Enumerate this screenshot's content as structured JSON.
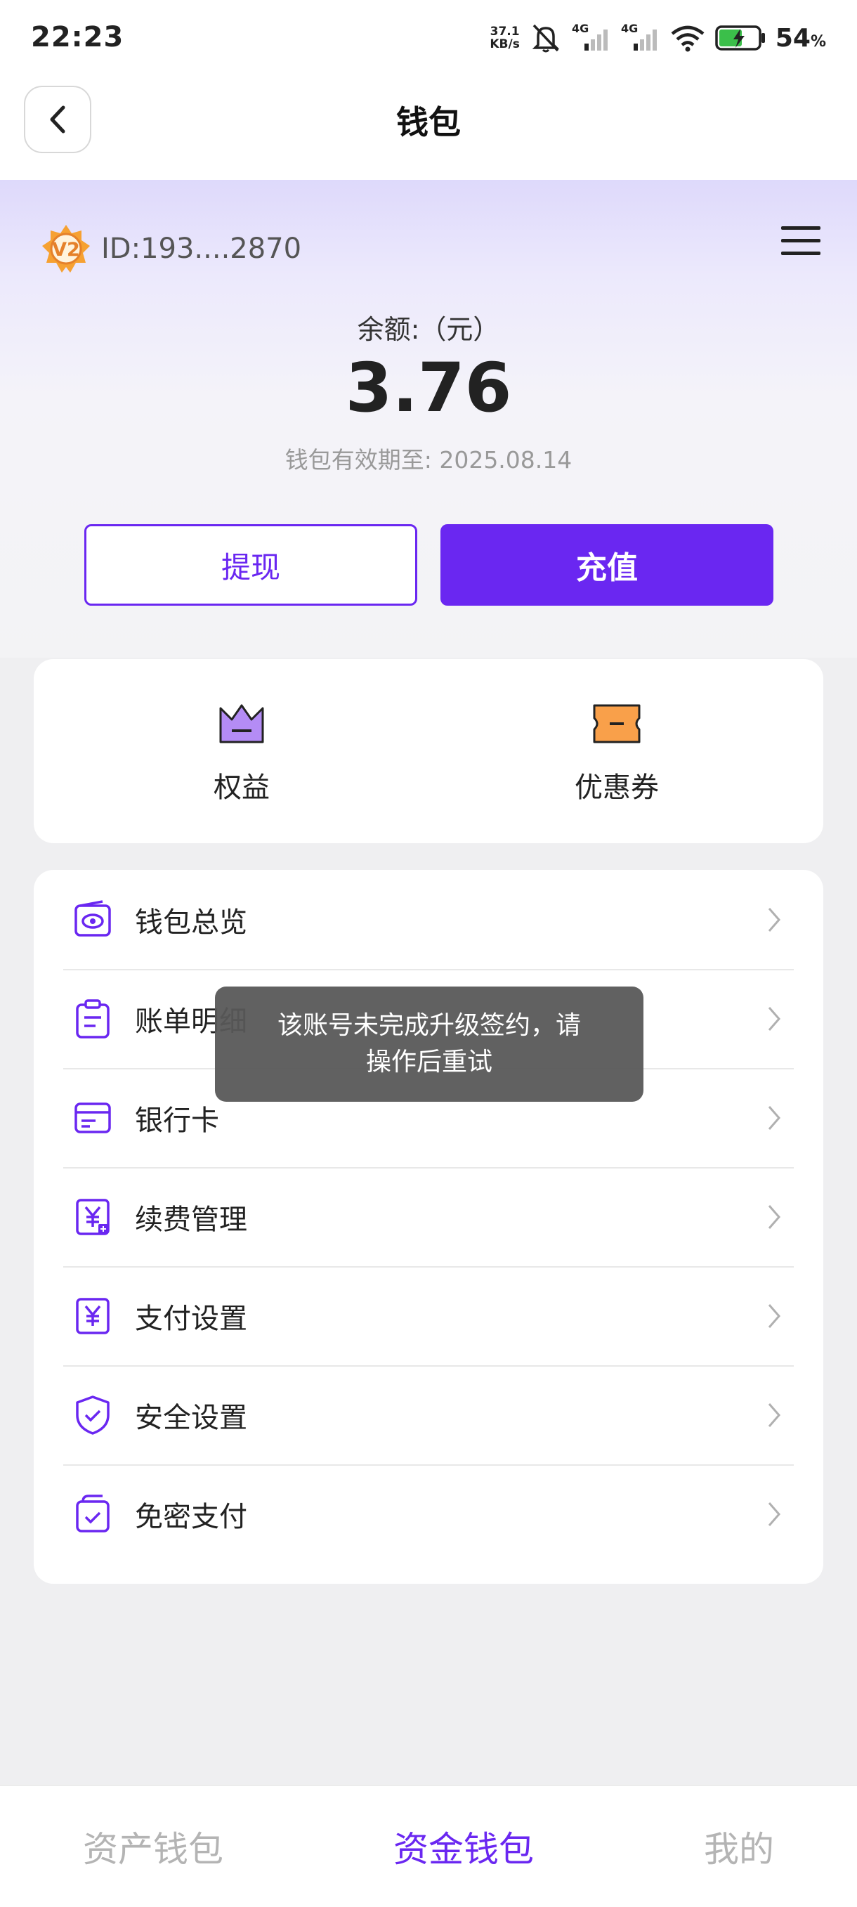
{
  "status_bar": {
    "time": "22:23",
    "net_speed_value": "37.1",
    "net_speed_unit": "KB/s",
    "sim1": "4G",
    "sim2": "4G",
    "battery": "54",
    "battery_unit": "%"
  },
  "header": {
    "title": "钱包",
    "back_icon": "chevron-left-icon"
  },
  "account": {
    "vip_badge_text": "V2",
    "user_id": "ID:193....2870",
    "menu_icon": "hamburger-menu-icon"
  },
  "balance": {
    "label": "余额:（元）",
    "value": "3.76",
    "validity": "钱包有效期至: 2025.08.14"
  },
  "actions": {
    "withdraw_label": "提现",
    "recharge_label": "充值"
  },
  "quick": [
    {
      "label": "权益",
      "icon": "crown-icon",
      "color": "#b48cf5"
    },
    {
      "label": "优惠券",
      "icon": "coupon-icon",
      "color": "#f9a04a"
    }
  ],
  "menu_items": [
    {
      "label": "钱包总览",
      "icon": "wallet-eye-icon"
    },
    {
      "label": "账单明细",
      "icon": "bill-clipboard-icon"
    },
    {
      "label": "银行卡",
      "icon": "bank-card-icon"
    },
    {
      "label": "续费管理",
      "icon": "renewal-yen-icon"
    },
    {
      "label": "支付设置",
      "icon": "payment-yen-icon"
    },
    {
      "label": "安全设置",
      "icon": "shield-check-icon"
    },
    {
      "label": "免密支付",
      "icon": "password-free-icon"
    }
  ],
  "toast": {
    "line1": "该账号未完成升级签约，请",
    "line2": "操作后重试"
  },
  "bottom_nav": [
    {
      "label": "资产钱包",
      "active": false
    },
    {
      "label": "资金钱包",
      "active": true
    },
    {
      "label": "我的",
      "active": false
    }
  ],
  "colors": {
    "accent": "#6a27f1",
    "accent_light": "#b48cf5",
    "coupon_orange": "#f9a04a"
  }
}
